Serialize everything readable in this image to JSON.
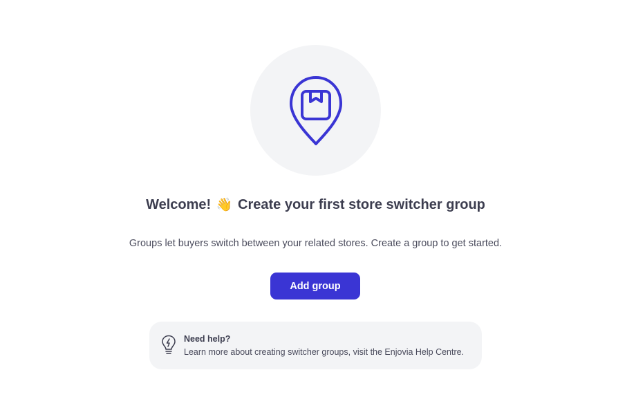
{
  "empty_state": {
    "illustration_icon": "store-location-pin-icon",
    "title_part1": "Welcome!",
    "title_emoji": "👋",
    "title_part2": "Create your first store switcher group",
    "description": "Groups let buyers switch between your related stores. Create a group to get started.",
    "add_button_label": "Add group"
  },
  "help_card": {
    "icon": "lightbulb-icon",
    "title": "Need help?",
    "text": "Learn more about creating switcher groups, visit the Enjovia Help Centre."
  },
  "colors": {
    "accent": "#3a35d4",
    "text": "#3c3d4f",
    "card_background": "#f3f4f6"
  }
}
